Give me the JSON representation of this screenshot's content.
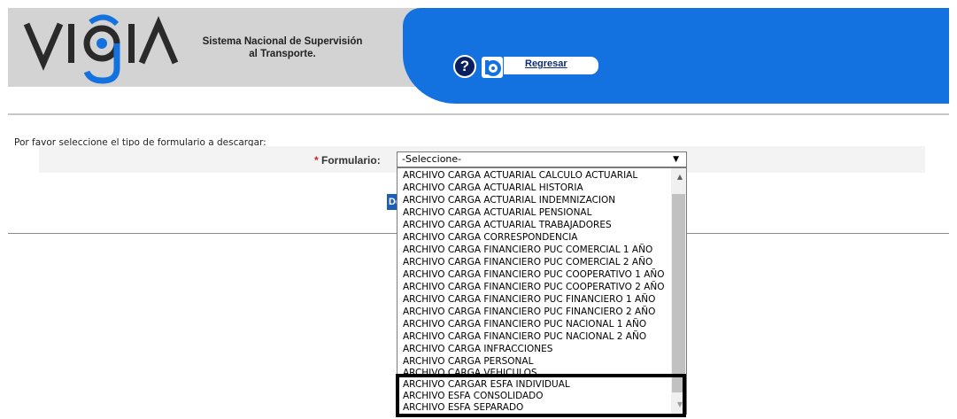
{
  "header": {
    "logo_text": "VIGIA",
    "subtitle_line1": "Sistema Nacional de Supervisión",
    "subtitle_line2": "al Transporte.",
    "help_symbol": "?",
    "back_label": "Regresar",
    "colors": {
      "blue": "#1472e0",
      "gray": "#d3d3d3",
      "navy": "#0a1f60"
    }
  },
  "form": {
    "prompt": "Por favor seleccione el tipo de formulario a descargar:",
    "required_mark": "*",
    "label": "Formulario:",
    "selected": "-Seleccione-",
    "download_label": "Descargar"
  },
  "dropdown": {
    "options": [
      "ARCHIVO CARGA ACTUARIAL CALCULO ACTUARIAL",
      "ARCHIVO CARGA ACTUARIAL HISTORIA",
      "ARCHIVO CARGA ACTUARIAL INDEMNIZACION",
      "ARCHIVO CARGA ACTUARIAL PENSIONAL",
      "ARCHIVO CARGA ACTUARIAL TRABAJADORES",
      "ARCHIVO CARGA CORRESPONDENCIA",
      "ARCHIVO CARGA FINANCIERO PUC COMERCIAL 1 AÑO",
      "ARCHIVO CARGA FINANCIERO PUC COMERCIAL 2 AÑO",
      "ARCHIVO CARGA FINANCIERO PUC COOPERATIVO 1 AÑO",
      "ARCHIVO CARGA FINANCIERO PUC COOPERATIVO 2 AÑO",
      "ARCHIVO CARGA FINANCIERO PUC FINANCIERO 1 AÑO",
      "ARCHIVO CARGA FINANCIERO PUC FINANCIERO 2 AÑO",
      "ARCHIVO CARGA FINANCIERO PUC NACIONAL 1 AÑO",
      "ARCHIVO CARGA FINANCIERO PUC NACIONAL 2 AÑO",
      "ARCHIVO CARGA INFRACCIONES",
      "ARCHIVO CARGA PERSONAL",
      "ARCHIVO CARGA VEHICULOS",
      "ARCHIVO CARGAR ESFA INDIVIDUAL",
      "ARCHIVO ESFA CONSOLIDADO",
      "ARCHIVO ESFA SEPARADO"
    ]
  }
}
